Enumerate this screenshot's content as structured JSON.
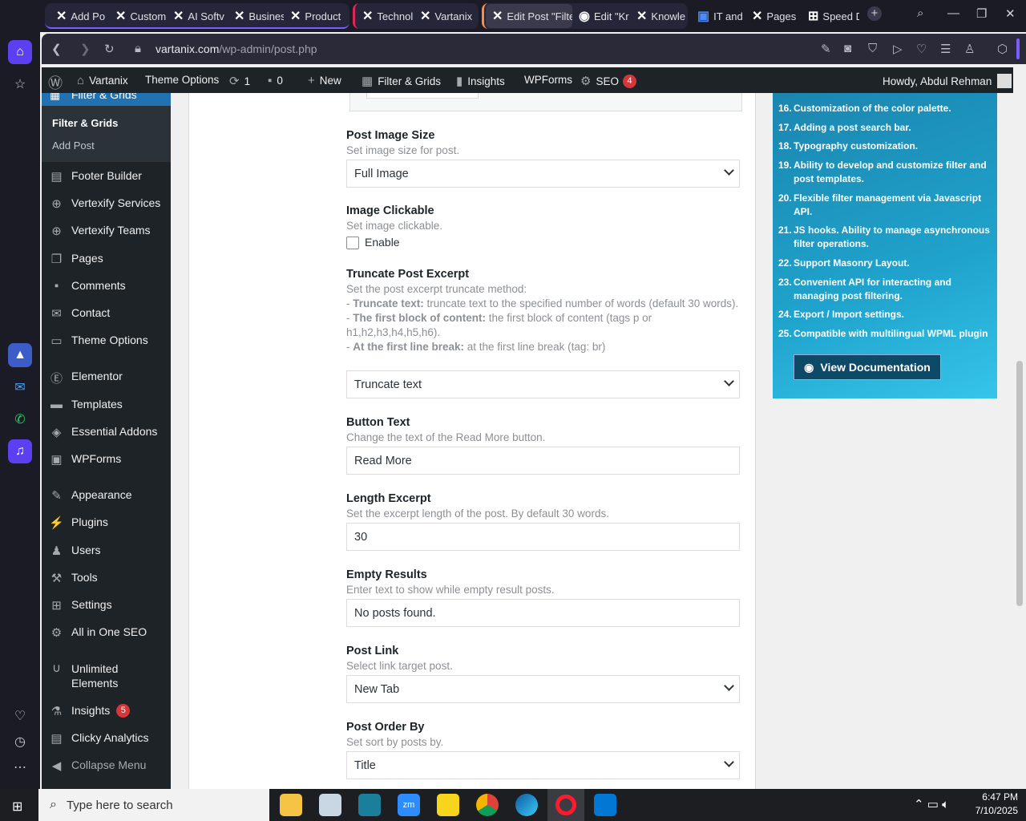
{
  "browser": {
    "tabs": [
      "Add Po",
      "Custom",
      "AI Softv",
      "Busines",
      "Product",
      "Technol",
      "Vartanix",
      "Edit Post \"Filte",
      "Edit \"Kr",
      "Knowle",
      "IT and D",
      "Pages",
      "Speed D"
    ],
    "url_domain": "vartanix.com",
    "url_path": "/wp-admin/post.php"
  },
  "adminbar": {
    "site": "Vartanix",
    "theme_options": "Theme Options",
    "updates": "1",
    "comments": "0",
    "new": "New",
    "filter_grids": "Filter & Grids",
    "insights": "Insights",
    "wpforms": "WPForms",
    "seo": "SEO",
    "seo_count": "4",
    "howdy": "Howdy, Abdul Rehman"
  },
  "menu": {
    "current": "Filter & Grids",
    "sub": [
      "Filter & Grids",
      "Add Post"
    ],
    "items": [
      "Footer Builder",
      "Vertexify Services",
      "Vertexify Teams",
      "Pages",
      "Comments",
      "Contact",
      "Theme Options",
      "Elementor",
      "Templates",
      "Essential Addons",
      "WPForms",
      "Appearance",
      "Plugins",
      "Users",
      "Tools",
      "Settings",
      "All in One SEO",
      "Unlimited Elements",
      "Insights",
      "Clicky Analytics",
      "Collapse Menu"
    ],
    "insights_count": "5"
  },
  "fields": {
    "image_size": {
      "label": "Post Image Size",
      "desc": "Set image size for post.",
      "value": "Full Image"
    },
    "clickable": {
      "label": "Image Clickable",
      "desc": "Set image clickable.",
      "option": "Enable"
    },
    "truncate": {
      "label": "Truncate Post Excerpt",
      "desc": "Set the post excerpt truncate method:",
      "l1b": "Truncate text:",
      "l1": " truncate text to the specified number of words (default 30 words).",
      "l2b": "The first block of content:",
      "l2": " the first block of content (tags p or h1,h2,h3,h4,h5,h6).",
      "l3b": "At the first line break:",
      "l3": " at the first line break (tag: br)",
      "value": "Truncate text"
    },
    "button_text": {
      "label": "Button Text",
      "desc": "Change the text of the Read More button.",
      "value": "Read More"
    },
    "length": {
      "label": "Length Excerpt",
      "desc": "Set the excerpt length of the post. By default 30 words.",
      "value": "30"
    },
    "empty": {
      "label": "Empty Results",
      "desc": "Enter text to show while empty result posts.",
      "value": "No posts found."
    },
    "link": {
      "label": "Post Link",
      "desc": "Select link target post.",
      "value": "New Tab"
    },
    "order": {
      "label": "Post Order By",
      "desc": "Set sort by posts by.",
      "value": "Title"
    }
  },
  "docs": {
    "features": [
      {
        "n": "16.",
        "t": "Customization of the color palette."
      },
      {
        "n": "17.",
        "t": "Adding a post search bar."
      },
      {
        "n": "18.",
        "t": "Typography customization."
      },
      {
        "n": "19.",
        "t": "Ability to develop and customize filter and post templates."
      },
      {
        "n": "20.",
        "t": "Flexible filter management via Javascript API."
      },
      {
        "n": "21.",
        "t": "JS hooks. Ability to manage asynchronous filter operations."
      },
      {
        "n": "22.",
        "t": "Support Masonry Layout."
      },
      {
        "n": "23.",
        "t": "Convenient API for interacting and managing post filtering."
      },
      {
        "n": "24.",
        "t": "Export / Import settings."
      },
      {
        "n": "25.",
        "t": "Compatible with multilingual WPML plugin"
      }
    ],
    "button": "View Documentation"
  },
  "taskbar": {
    "search": "Type here to search",
    "time": "6:47 PM",
    "date": "7/10/2025"
  }
}
